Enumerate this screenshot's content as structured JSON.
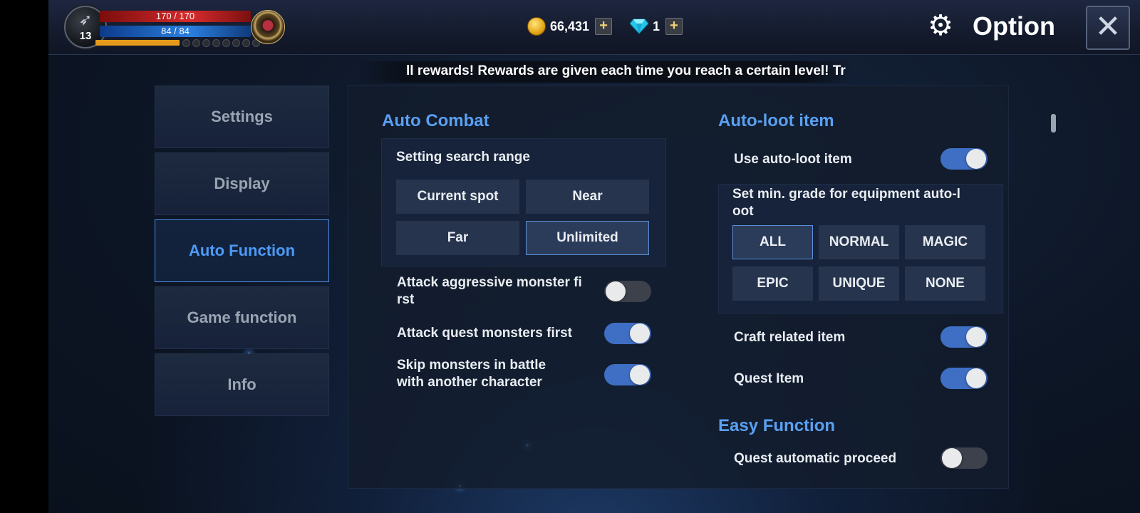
{
  "player": {
    "level": "13",
    "hp": "170 / 170",
    "mp": "84 / 84",
    "portrait_icon": "bow-icon",
    "emblem_icon": "wing-emblem-icon"
  },
  "currency": {
    "gold": "66,431",
    "gems": "1",
    "plus": "+",
    "gold_icon": "coin-icon",
    "gem_icon": "diamond-icon"
  },
  "header": {
    "title": "Option",
    "gear_glyph": "⚙",
    "close_glyph": "✕"
  },
  "ticker": {
    "text": "ll rewards!     Rewards are given each time you reach a certain level! Tr"
  },
  "nav": {
    "items": [
      {
        "label": "Settings",
        "active": false
      },
      {
        "label": "Display",
        "active": false
      },
      {
        "label": "Auto Function",
        "active": true
      },
      {
        "label": "Game function",
        "active": false
      },
      {
        "label": "Info",
        "active": false
      }
    ]
  },
  "auto_combat": {
    "title": "Auto Combat",
    "range_label": "Setting search range",
    "range_options": [
      "Current spot",
      "Near",
      "Far",
      "Unlimited"
    ],
    "selected_range": "Unlimited",
    "toggles": [
      {
        "label_line1": "Attack aggressive monster fi",
        "label_line2": "rst",
        "on": false
      },
      {
        "label_line1": "Attack quest monsters first",
        "label_line2": "",
        "on": true
      },
      {
        "label_line1": "Skip monsters in battle",
        "label_line2": "with another character",
        "on": true
      }
    ]
  },
  "auto_loot": {
    "title": "Auto-loot item",
    "use_label": "Use auto-loot item",
    "use_on": true,
    "grade_label_line1": "Set min. grade for equipment auto-l",
    "grade_label_line2": "oot",
    "grades": [
      "ALL",
      "NORMAL",
      "MAGIC",
      "EPIC",
      "UNIQUE",
      "NONE"
    ],
    "selected_grade": "ALL",
    "craft_label": "Craft related item",
    "craft_on": true,
    "quest_label": "Quest Item",
    "quest_on": true
  },
  "easy_function": {
    "title": "Easy Function",
    "quest_auto_label": "Quest automatic proceed",
    "quest_auto_on": false
  },
  "colors": {
    "accent": "#5aa0f2",
    "toggle_on": "#3f6fc4",
    "toggle_off": "#3c414b",
    "hp": "#d62b2b",
    "mp": "#2a7fe0"
  }
}
